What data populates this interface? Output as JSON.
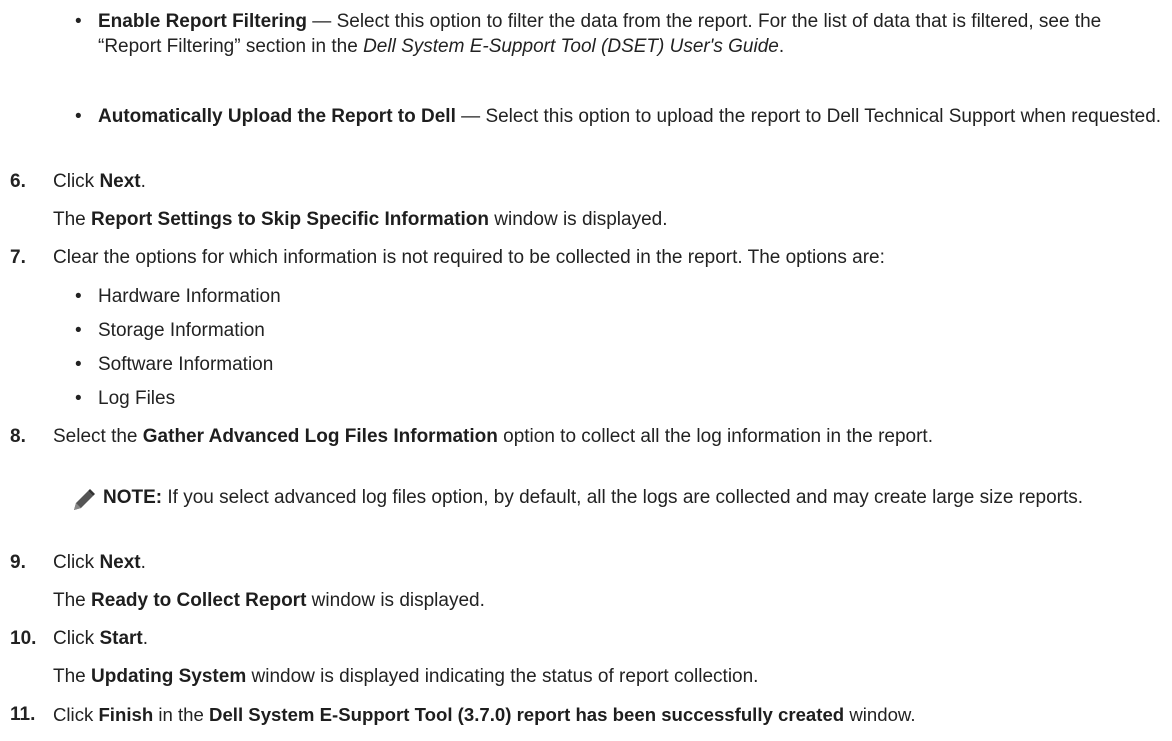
{
  "filter_item": {
    "title": "Enable Report Filtering",
    "dash": " — ",
    "text_a": "Select this option to filter the data from the report. For the list of data that is filtered, see the “Report Filtering” section in the ",
    "guide": "Dell System E-Support Tool (DSET) User's Guide",
    "text_b": "."
  },
  "upload_item": {
    "title": "Automatically Upload the Report to Dell",
    "dash": " — ",
    "text": "Select this option to upload the report to Dell Technical Support when requested."
  },
  "step6": {
    "num": "6.",
    "click": "Click ",
    "button": "Next",
    "end": ".",
    "sub_a": "The ",
    "window": "Report Settings to Skip Specific Information",
    "sub_b": " window is displayed."
  },
  "step7": {
    "num": "7.",
    "text": "Clear the options for which information is not required to be collected in the report. The options are:",
    "options": [
      "Hardware Information",
      "Storage Information",
      "Software Information",
      "Log Files"
    ]
  },
  "step8": {
    "num": "8.",
    "a": "Select the ",
    "option": "Gather Advanced Log Files Information",
    "b": " option to collect all the log information in the report."
  },
  "note": {
    "label": "NOTE:",
    "text": " If you select advanced log files option, by default, all the logs are collected and may create large size reports."
  },
  "step9": {
    "num": "9.",
    "click": "Click ",
    "button": "Next",
    "end": ".",
    "sub_a": "The ",
    "window": "Ready to Collect Report",
    "sub_b": " window is displayed."
  },
  "step10": {
    "num": "10.",
    "click": "Click ",
    "button": "Start",
    "end": ".",
    "sub_a": "The ",
    "window": "Updating System",
    "sub_b": " window is displayed indicating the status of report collection."
  },
  "step11": {
    "num": "11.",
    "click": "Click ",
    "button": "Finish",
    "mid": " in the ",
    "window": "Dell System E-Support Tool (3.7.0) report has been successfully created",
    "end": " window."
  },
  "bullet_char": "•"
}
